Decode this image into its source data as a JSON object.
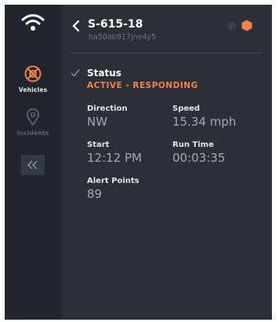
{
  "sidebar": {
    "logo_icon": "wifi-signal-logo-icon",
    "items": [
      {
        "label": "Vehicles",
        "icon": "vehicle-target-icon",
        "active": true
      },
      {
        "label": "Incidents",
        "icon": "map-pin-icon",
        "active": false
      }
    ],
    "collapse_icon": "double-chevron-left-icon"
  },
  "header": {
    "title": "S-615-18",
    "subtitle": "ha50ab917jne4y5",
    "back_icon": "chevron-left-icon",
    "settings_icon": "gear-icon",
    "status_icon": "hexagon-icon"
  },
  "status": {
    "label": "Status",
    "value": "ACTIVE - RESPONDING"
  },
  "fields": {
    "direction": {
      "label": "Direction",
      "value": "NW"
    },
    "speed": {
      "label": "Speed",
      "value": "15.34 mph"
    },
    "start": {
      "label": "Start",
      "value": "12:12 PM"
    },
    "run_time": {
      "label": "Run Time",
      "value": "00:03:35"
    },
    "alert_points": {
      "label": "Alert Points",
      "value": "89"
    }
  },
  "colors": {
    "accent": "#f0824a",
    "panel_bg": "#2c2f38",
    "rail_bg": "#22252d"
  }
}
